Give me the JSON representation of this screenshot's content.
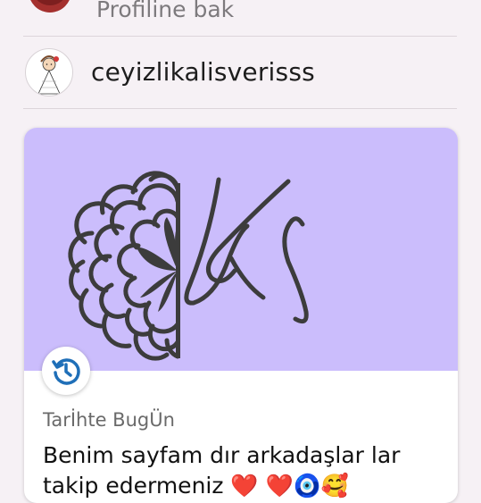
{
  "top_item": {
    "label": "Profiline bak"
  },
  "profile": {
    "username": "ceyizlikalisverisss",
    "avatar_icon": "bride-cartoon-avatar"
  },
  "card": {
    "image_bg": "#cbbdfc",
    "logo_letters": "KS",
    "history_icon": "history-clock-icon",
    "label": "Tarİhte BugÜn",
    "text_line1": "Benim sayfam dır  arkadaşlar lar",
    "text_line2": "takip edermeniz  ❤️ ❤️🧿🥰"
  },
  "colors": {
    "background": "#f6f1f5",
    "accent_purple": "#cbbdfc",
    "icon_blue": "#1f6fb8"
  }
}
